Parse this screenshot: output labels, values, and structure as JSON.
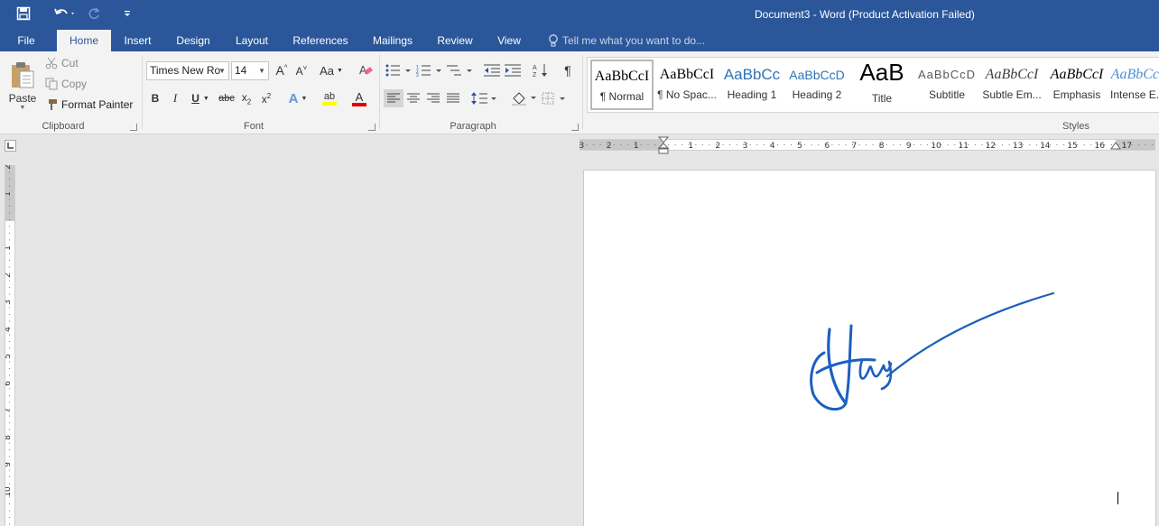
{
  "window": {
    "title": "Document3 - Word (Product Activation Failed)"
  },
  "qat": {
    "save_icon": "save-icon",
    "undo_icon": "undo-icon",
    "redo_icon": "redo-icon",
    "customize_icon": "customize-qat-icon"
  },
  "tabs": [
    "File",
    "Home",
    "Insert",
    "Design",
    "Layout",
    "References",
    "Mailings",
    "Review",
    "View"
  ],
  "active_tab": "Home",
  "tell_me": {
    "placeholder": "Tell me what you want to do..."
  },
  "clipboard": {
    "paste": "Paste",
    "cut": "Cut",
    "copy": "Copy",
    "format_painter": "Format Painter",
    "group_label": "Clipboard"
  },
  "font": {
    "name": "Times New Ro",
    "size": "14",
    "group_label": "Font",
    "change_case": "Aa"
  },
  "paragraph": {
    "group_label": "Paragraph"
  },
  "styles": {
    "group_label": "Styles",
    "items": [
      {
        "preview": "AaBbCcI",
        "name": "¶ Normal",
        "selected": true
      },
      {
        "preview": "AaBbCcI",
        "name": "¶ No Spac..."
      },
      {
        "preview": "AaBbCc",
        "name": "Heading 1"
      },
      {
        "preview": "AaBbCcD",
        "name": "Heading 2"
      },
      {
        "preview": "AaB",
        "name": "Title"
      },
      {
        "preview": "AaBbCcD",
        "name": "Subtitle"
      },
      {
        "preview": "AaBbCcI",
        "name": "Subtle Em..."
      },
      {
        "preview": "AaBbCcI",
        "name": "Emphasis"
      },
      {
        "preview": "AaBbCcI",
        "name": "Intense E..."
      }
    ]
  },
  "ruler": {
    "h_labels": [
      "3",
      "2",
      "1",
      "1",
      "2",
      "3",
      "4",
      "5",
      "6",
      "7",
      "8",
      "9",
      "10",
      "11",
      "12",
      "13",
      "14",
      "15",
      "16",
      "17"
    ],
    "v_labels": [
      "2",
      "1",
      "1",
      "2",
      "3",
      "4",
      "5",
      "6",
      "7",
      "8",
      "9",
      "10"
    ]
  },
  "colors": {
    "accent": "#2b579a",
    "signature_ink": "#1c5fbf",
    "highlight": "#ffff00",
    "font_color": "#e00000"
  }
}
